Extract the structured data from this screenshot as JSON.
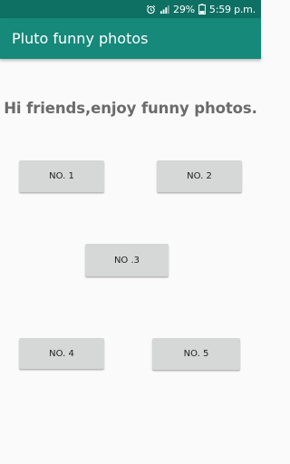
{
  "status_bar": {
    "battery_percent": "29%",
    "time": "5:59 p.m.",
    "icons": [
      "alarm-icon",
      "signal-icon",
      "battery-icon"
    ]
  },
  "app_bar": {
    "title": "Pluto funny photos"
  },
  "main": {
    "headline": "Hi friends,enjoy funny photos.",
    "buttons": [
      {
        "label": "NO. 1"
      },
      {
        "label": "NO. 2"
      },
      {
        "label": "NO .3"
      },
      {
        "label": "NO. 4"
      },
      {
        "label": "NO. 5"
      }
    ]
  },
  "colors": {
    "status_bar": "#0e6f63",
    "app_bar": "#16897a",
    "background": "#fafafa",
    "button": "#d6d7d7",
    "headline_text": "#6b6b6b"
  }
}
